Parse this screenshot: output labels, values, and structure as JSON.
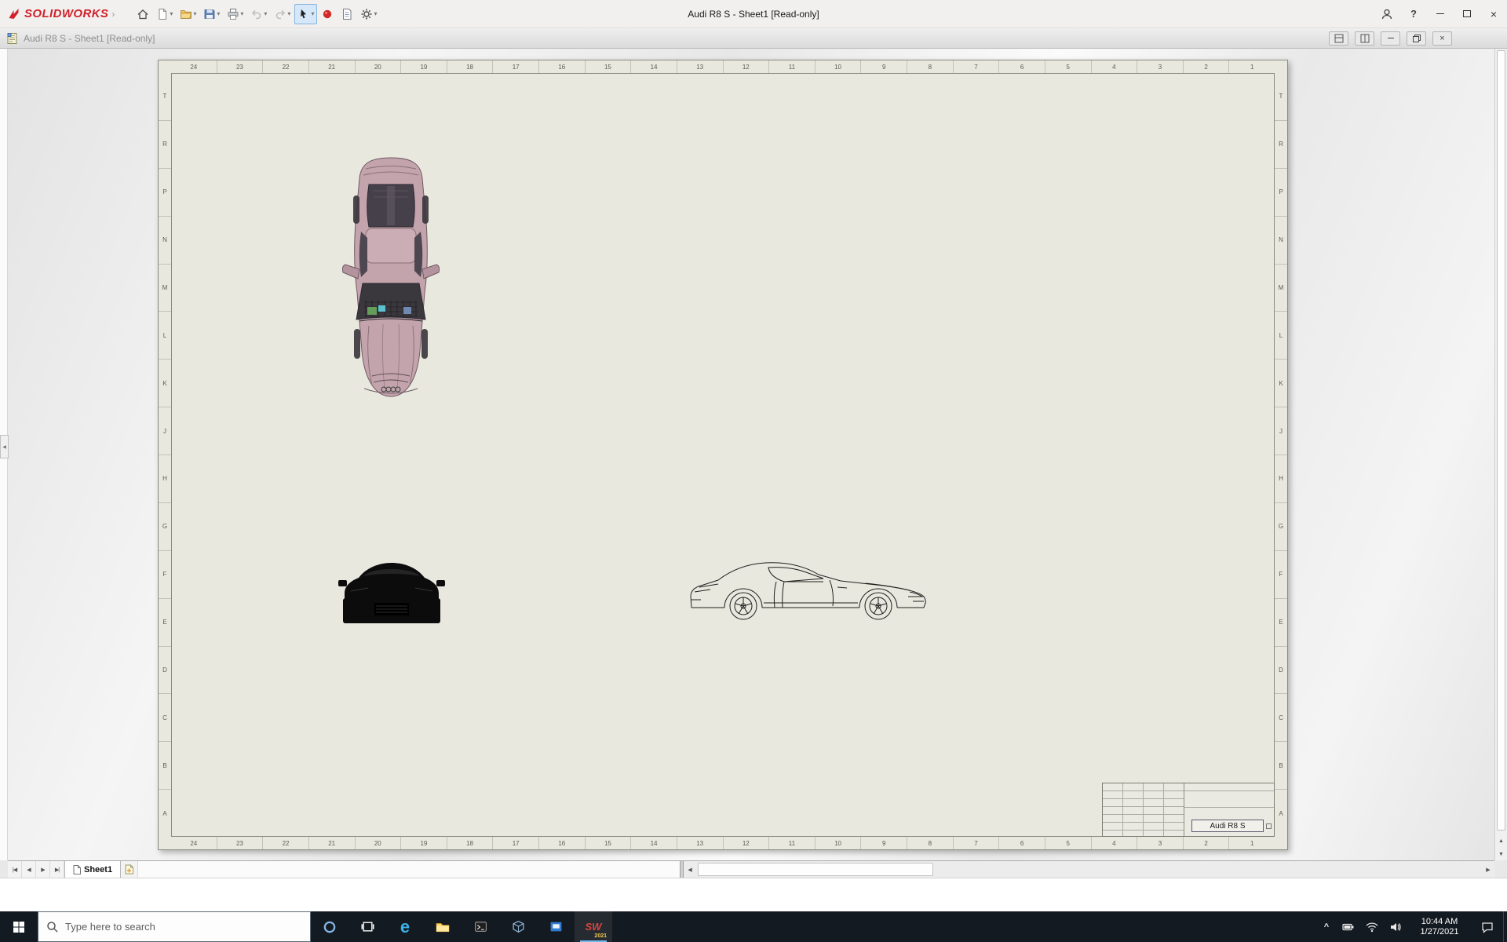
{
  "colors": {
    "brand-red": "#d0222b",
    "taskbar-bg": "#141a21",
    "sheet-bg": "#e9e8df",
    "frame-line": "#8b8b80",
    "car-body": "#c3a4ad"
  },
  "titlebar": {
    "brand": "SOLIDWORKS",
    "title": "Audi R8 S - Sheet1 [Read-only]"
  },
  "docbar": {
    "title": "Audi R8 S - Sheet1 [Read-only]"
  },
  "glyphs": {
    "dropdown": "▾",
    "brand_arrow": "›",
    "help": "?",
    "close": "×",
    "collapse_left": "◀",
    "nav_first": "|◀",
    "nav_prev": "◀",
    "nav_next": "▶",
    "nav_last": "▶|",
    "scroll_up": "▲",
    "scroll_down": "▼",
    "scroll_left": "◀",
    "scroll_right": "▶",
    "edge_e": "e",
    "sw": "SW",
    "hidden_icons": "^"
  },
  "sheet": {
    "zone_numbers": [
      "24",
      "23",
      "22",
      "21",
      "20",
      "19",
      "18",
      "17",
      "16",
      "15",
      "14",
      "13",
      "12",
      "11",
      "10",
      "9",
      "8",
      "7",
      "6",
      "5",
      "4",
      "3",
      "2",
      "1"
    ],
    "zone_letters": [
      "T",
      "R",
      "P",
      "N",
      "M",
      "L",
      "K",
      "J",
      "H",
      "G",
      "F",
      "E",
      "D",
      "C",
      "B",
      "A"
    ],
    "title_block": {
      "part_name": "Audi R8 S"
    }
  },
  "tabs": {
    "sheet1_label": "Sheet1"
  },
  "taskbar": {
    "search_placeholder": "Type here to search",
    "clock_time": "10:44 AM",
    "clock_date": "1/27/2021",
    "solidworks_badge": "2021"
  }
}
